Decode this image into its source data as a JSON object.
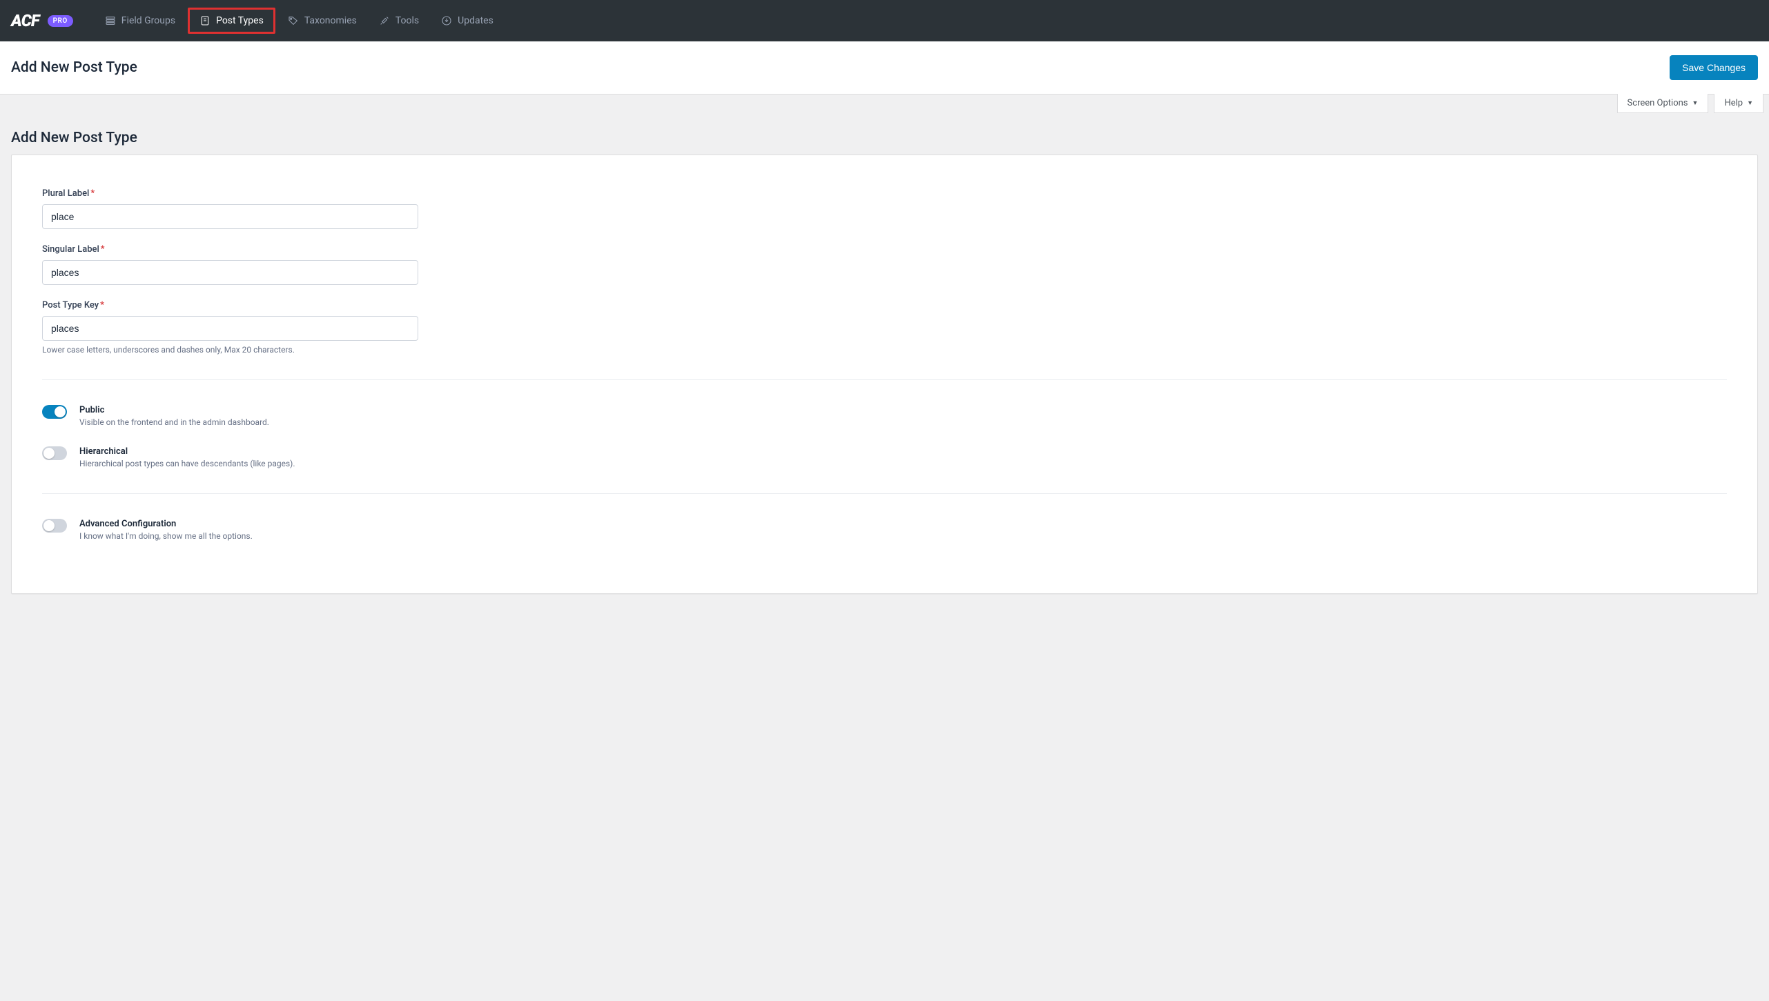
{
  "brand": {
    "logo": "ACF",
    "badge": "PRO"
  },
  "nav": {
    "field_groups": "Field Groups",
    "post_types": "Post Types",
    "taxonomies": "Taxonomies",
    "tools": "Tools",
    "updates": "Updates"
  },
  "header": {
    "title": "Add New Post Type",
    "save_label": "Save Changes"
  },
  "sub_toolbar": {
    "screen_options": "Screen Options",
    "help": "Help"
  },
  "content": {
    "heading": "Add New Post Type"
  },
  "fields": {
    "plural": {
      "label": "Plural Label",
      "value": "place"
    },
    "singular": {
      "label": "Singular Label",
      "value": "places"
    },
    "key": {
      "label": "Post Type Key",
      "value": "places",
      "help": "Lower case letters, underscores and dashes only, Max 20 characters."
    }
  },
  "toggles": {
    "public": {
      "title": "Public",
      "desc": "Visible on the frontend and in the admin dashboard.",
      "on": true
    },
    "hierarchical": {
      "title": "Hierarchical",
      "desc": "Hierarchical post types can have descendants (like pages).",
      "on": false
    },
    "advanced": {
      "title": "Advanced Configuration",
      "desc": "I know what I'm doing, show me all the options.",
      "on": false
    }
  }
}
